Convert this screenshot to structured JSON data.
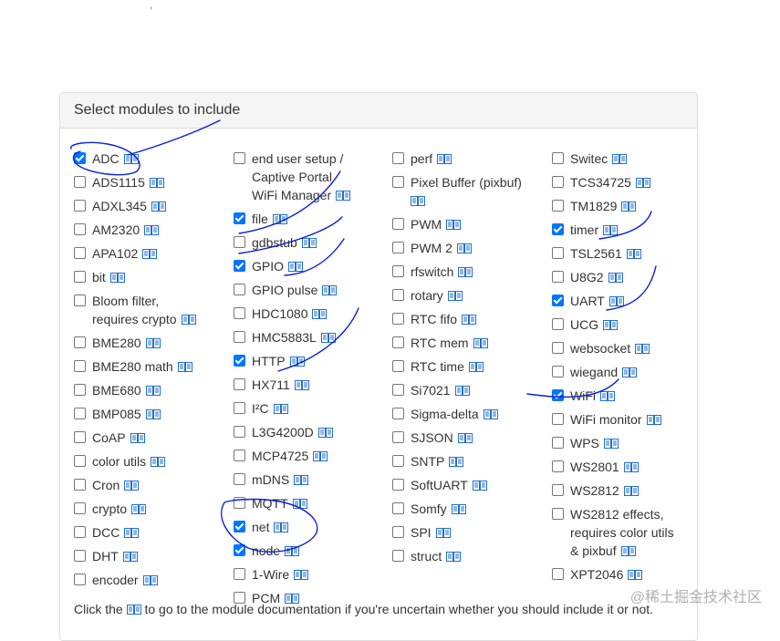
{
  "panel": {
    "title": "Select modules to include"
  },
  "columns": [
    [
      {
        "label": "ADC",
        "checked": true
      },
      {
        "label": "ADS1115",
        "checked": false
      },
      {
        "label": "ADXL345",
        "checked": false
      },
      {
        "label": "AM2320",
        "checked": false
      },
      {
        "label": "APA102",
        "checked": false
      },
      {
        "label": "bit",
        "checked": false
      },
      {
        "label": "Bloom filter,\nrequires crypto",
        "checked": false
      },
      {
        "label": "BME280",
        "checked": false
      },
      {
        "label": "BME280 math",
        "checked": false
      },
      {
        "label": "BME680",
        "checked": false
      },
      {
        "label": "BMP085",
        "checked": false
      },
      {
        "label": "CoAP",
        "checked": false
      },
      {
        "label": "color utils",
        "checked": false
      },
      {
        "label": "Cron",
        "checked": false
      },
      {
        "label": "crypto",
        "checked": false
      },
      {
        "label": "DCC",
        "checked": false
      },
      {
        "label": "DHT",
        "checked": false
      },
      {
        "label": "encoder",
        "checked": false
      }
    ],
    [
      {
        "label": "end user setup /\nCaptive Portal\nWiFi Manager",
        "checked": false
      },
      {
        "label": "file",
        "checked": true
      },
      {
        "label": "gdbstub",
        "checked": false
      },
      {
        "label": "GPIO",
        "checked": true
      },
      {
        "label": "GPIO pulse",
        "checked": false
      },
      {
        "label": "HDC1080",
        "checked": false
      },
      {
        "label": "HMC5883L",
        "checked": false
      },
      {
        "label": "HTTP",
        "checked": true
      },
      {
        "label": "HX711",
        "checked": false
      },
      {
        "label": "I²C",
        "checked": false
      },
      {
        "label": "L3G4200D",
        "checked": false
      },
      {
        "label": "MCP4725",
        "checked": false
      },
      {
        "label": "mDNS",
        "checked": false
      },
      {
        "label": "MQTT",
        "checked": false
      },
      {
        "label": "net",
        "checked": true
      },
      {
        "label": "node",
        "checked": true
      },
      {
        "label": "1-Wire",
        "checked": false
      },
      {
        "label": "PCM",
        "checked": false
      }
    ],
    [
      {
        "label": "perf",
        "checked": false
      },
      {
        "label": "Pixel Buffer (pixbuf)",
        "checked": false,
        "iconBelow": true
      },
      {
        "label": "PWM",
        "checked": false
      },
      {
        "label": "PWM 2",
        "checked": false
      },
      {
        "label": "rfswitch",
        "checked": false
      },
      {
        "label": "rotary",
        "checked": false
      },
      {
        "label": "RTC fifo",
        "checked": false
      },
      {
        "label": "RTC mem",
        "checked": false
      },
      {
        "label": "RTC time",
        "checked": false
      },
      {
        "label": "Si7021",
        "checked": false
      },
      {
        "label": "Sigma-delta",
        "checked": false
      },
      {
        "label": "SJSON",
        "checked": false
      },
      {
        "label": "SNTP",
        "checked": false
      },
      {
        "label": "SoftUART",
        "checked": false
      },
      {
        "label": "Somfy",
        "checked": false
      },
      {
        "label": "SPI",
        "checked": false
      },
      {
        "label": "struct",
        "checked": false
      }
    ],
    [
      {
        "label": "Switec",
        "checked": false
      },
      {
        "label": "TCS34725",
        "checked": false
      },
      {
        "label": "TM1829",
        "checked": false
      },
      {
        "label": "timer",
        "checked": true
      },
      {
        "label": "TSL2561",
        "checked": false
      },
      {
        "label": "U8G2",
        "checked": false
      },
      {
        "label": "UART",
        "checked": true
      },
      {
        "label": "UCG",
        "checked": false
      },
      {
        "label": "websocket",
        "checked": false
      },
      {
        "label": "wiegand",
        "checked": false
      },
      {
        "label": "WiFi",
        "checked": true
      },
      {
        "label": "WiFi monitor",
        "checked": false
      },
      {
        "label": "WPS",
        "checked": false
      },
      {
        "label": "WS2801",
        "checked": false
      },
      {
        "label": "WS2812",
        "checked": false
      },
      {
        "label": "WS2812 effects,\nrequires color utils\n& pixbuf",
        "checked": false
      },
      {
        "label": "XPT2046",
        "checked": false
      }
    ]
  ],
  "footer": {
    "before_icon": "Click the",
    "after_icon": "to go to the module documentation if you're uncertain whether you should include it or not."
  },
  "watermark": "@稀土掘金技术社区",
  "colors": {
    "checkbox_checked": "#0075ff",
    "ink": "#0a1fd6",
    "doc_icon": "#1f6fd1"
  },
  "icon": "doc-icon"
}
